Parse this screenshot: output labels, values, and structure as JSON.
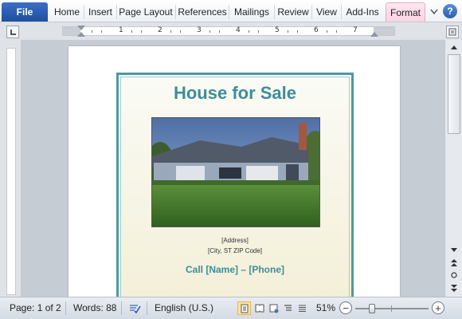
{
  "ribbon": {
    "file_label": "File",
    "tabs": [
      "Home",
      "Insert",
      "Page Layout",
      "References",
      "Mailings",
      "Review",
      "View",
      "Add-Ins",
      "Format"
    ],
    "help_label": "?"
  },
  "ruler": {
    "numbers": [
      "1",
      "2",
      "3",
      "4",
      "5",
      "6",
      "7"
    ]
  },
  "document": {
    "flyer_title": "House for Sale",
    "address_line1": "[Address]",
    "address_line2": "[City, ST  ZIP Code]",
    "call_line": "Call [Name] – [Phone]"
  },
  "status_bar": {
    "page": "Page: 1 of 2",
    "words": "Words: 88",
    "language": "English (U.S.)",
    "zoom_percent": "51%",
    "zoom_minus": "−",
    "zoom_plus": "+",
    "zoom_level_fraction": 0.51
  },
  "colors": {
    "accent_teal": "#3b8e99",
    "file_tab_blue": "#2a5caa",
    "format_tab_pink": "#fbd3e3"
  }
}
